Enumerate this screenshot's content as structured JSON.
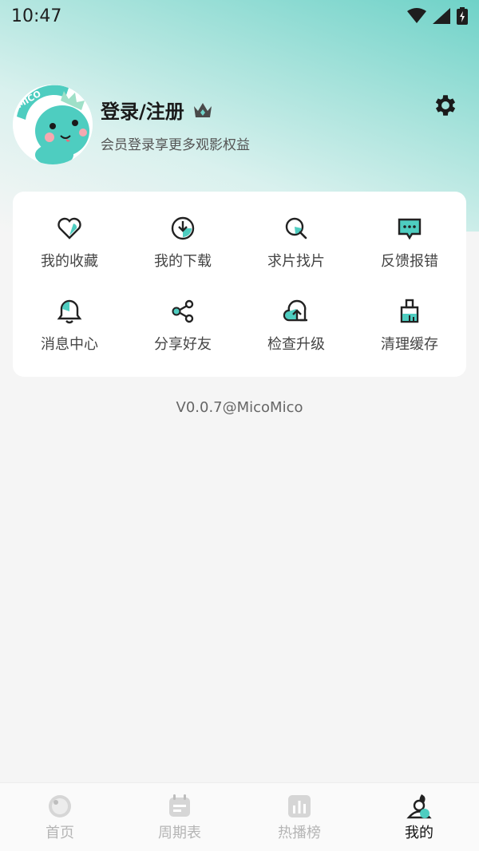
{
  "status_bar": {
    "time": "10:47"
  },
  "profile": {
    "title": "登录/注册",
    "subtitle": "会员登录享更多观影权益",
    "avatar_text": "MICO"
  },
  "menu": {
    "items": [
      {
        "label": "我的收藏",
        "icon": "heart-icon"
      },
      {
        "label": "我的下载",
        "icon": "download-icon"
      },
      {
        "label": "求片找片",
        "icon": "search-icon"
      },
      {
        "label": "反馈报错",
        "icon": "feedback-icon"
      },
      {
        "label": "消息中心",
        "icon": "bell-icon"
      },
      {
        "label": "分享好友",
        "icon": "share-icon"
      },
      {
        "label": "检查升级",
        "icon": "upgrade-icon"
      },
      {
        "label": "清理缓存",
        "icon": "broom-icon"
      }
    ]
  },
  "version": "V0.0.7@MicoMico",
  "bottom_nav": {
    "items": [
      {
        "label": "首页",
        "icon": "home-icon",
        "active": false
      },
      {
        "label": "周期表",
        "icon": "calendar-icon",
        "active": false
      },
      {
        "label": "热播榜",
        "icon": "chart-icon",
        "active": false
      },
      {
        "label": "我的",
        "icon": "profile-icon",
        "active": true
      }
    ]
  },
  "colors": {
    "accent": "#4ecdc0",
    "dark": "#222222"
  }
}
